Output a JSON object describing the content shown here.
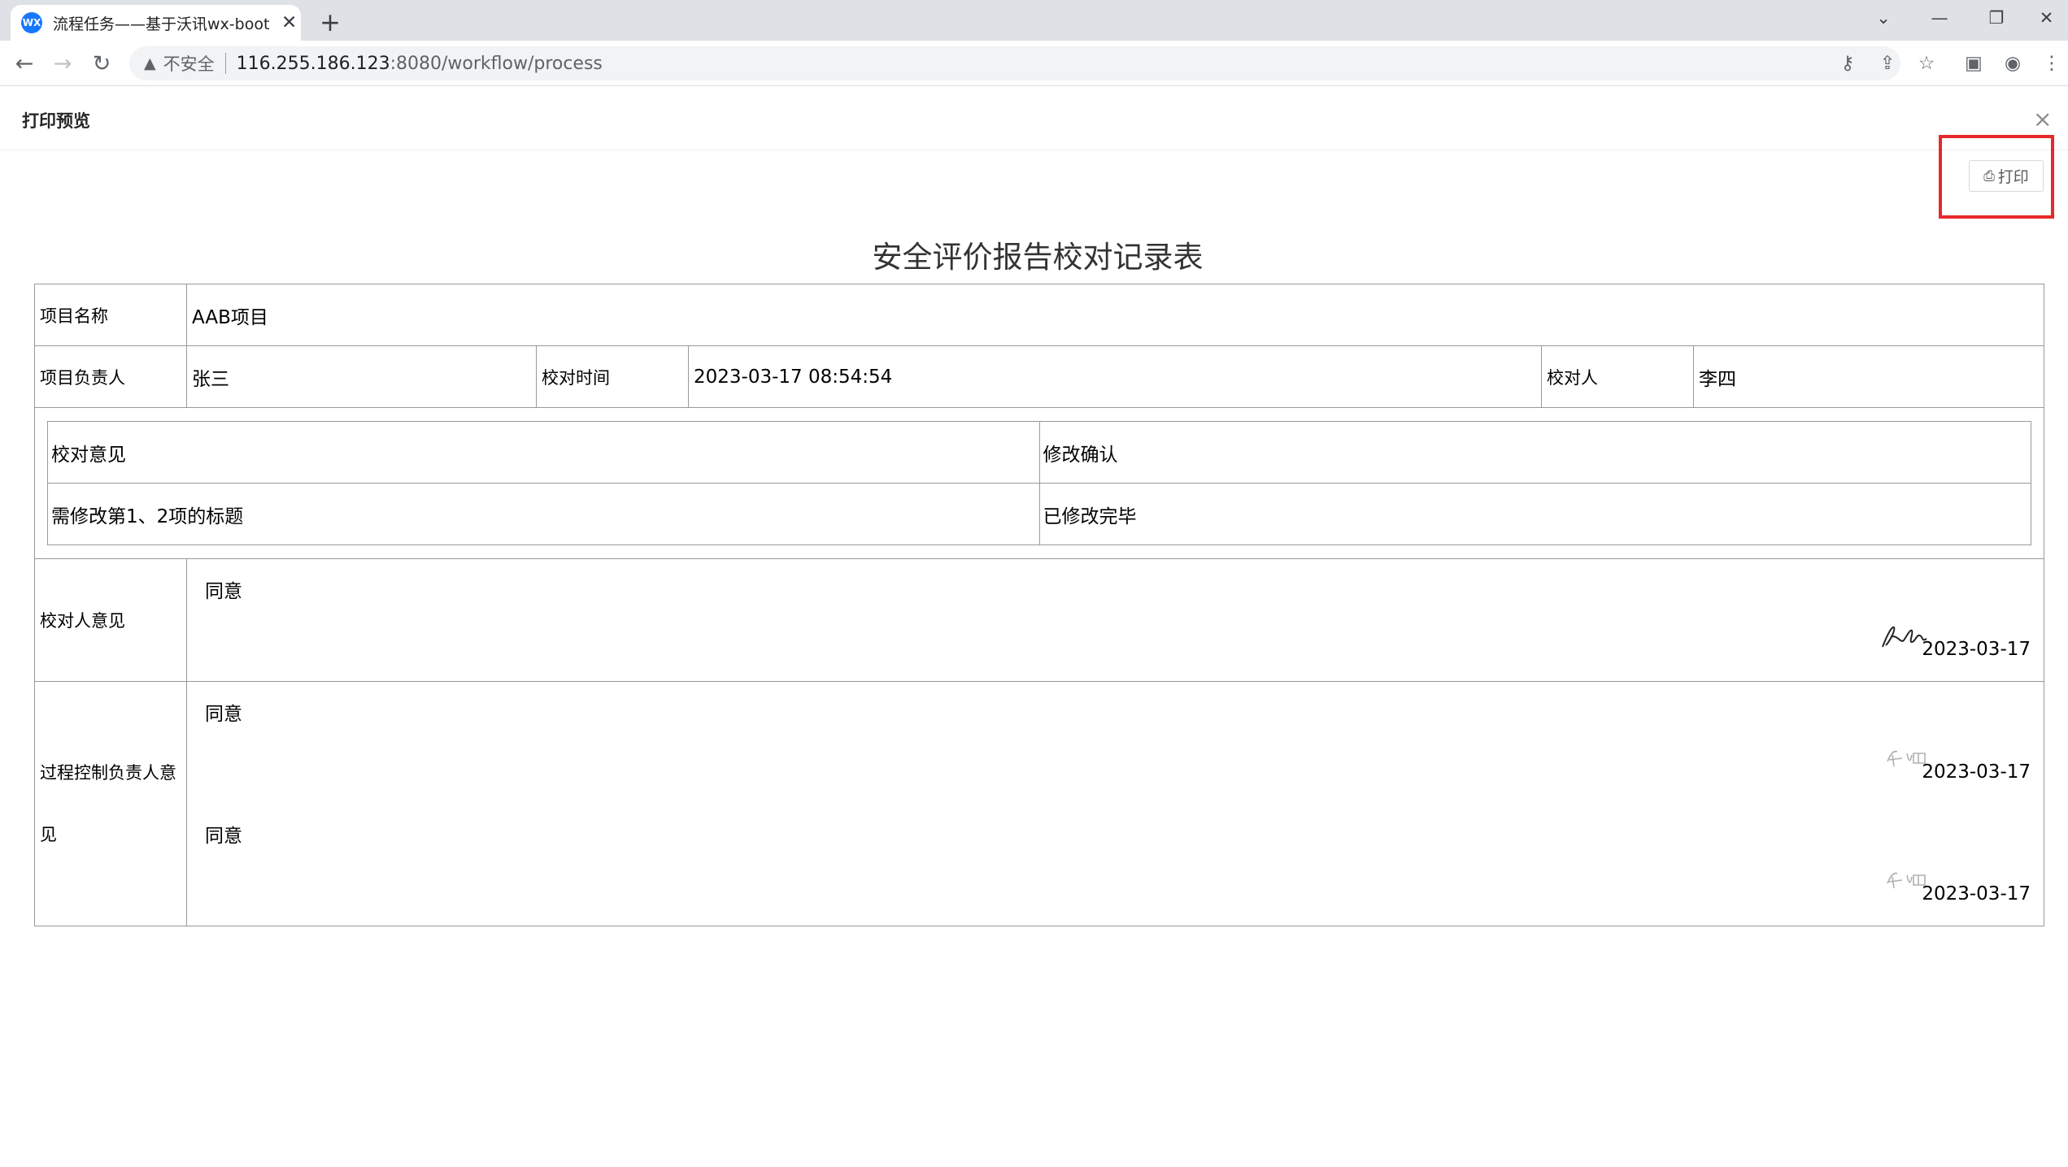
{
  "browser": {
    "tab_title": "流程任务——基于沃讯wx-boot",
    "favicon_text": "WX",
    "new_tab": "+",
    "omnibox": {
      "insecure_label": "不安全",
      "host": "116.255.186.123",
      "path": ":8080/workflow/process"
    }
  },
  "dialog": {
    "title": "打印预览",
    "print_label": "打印"
  },
  "report": {
    "title": "安全评价报告校对记录表",
    "project_name_label": "项目名称",
    "project_name": "AAB项目",
    "leader_label": "项目负责人",
    "leader": "张三",
    "check_time_label": "校对时间",
    "check_time": "2023-03-17 08:54:54",
    "checker_label": "校对人",
    "checker": "李四",
    "comments": {
      "col1": "校对意见",
      "col2": "修改确认",
      "rows": [
        {
          "opinion": "需修改第1、2项的标题",
          "confirm": "已修改完毕"
        }
      ]
    },
    "checker_opinion_label": "校对人意见",
    "checker_opinion": {
      "text": "同意",
      "date": "2023-03-17"
    },
    "process_label": "过程控制负责人意见",
    "process_opinions": [
      {
        "text": "同意",
        "date": "2023-03-17"
      },
      {
        "text": "同意",
        "date": "2023-03-17"
      }
    ]
  },
  "colors": {
    "highlight": "#e8282b",
    "favicon": "#1677ff"
  }
}
